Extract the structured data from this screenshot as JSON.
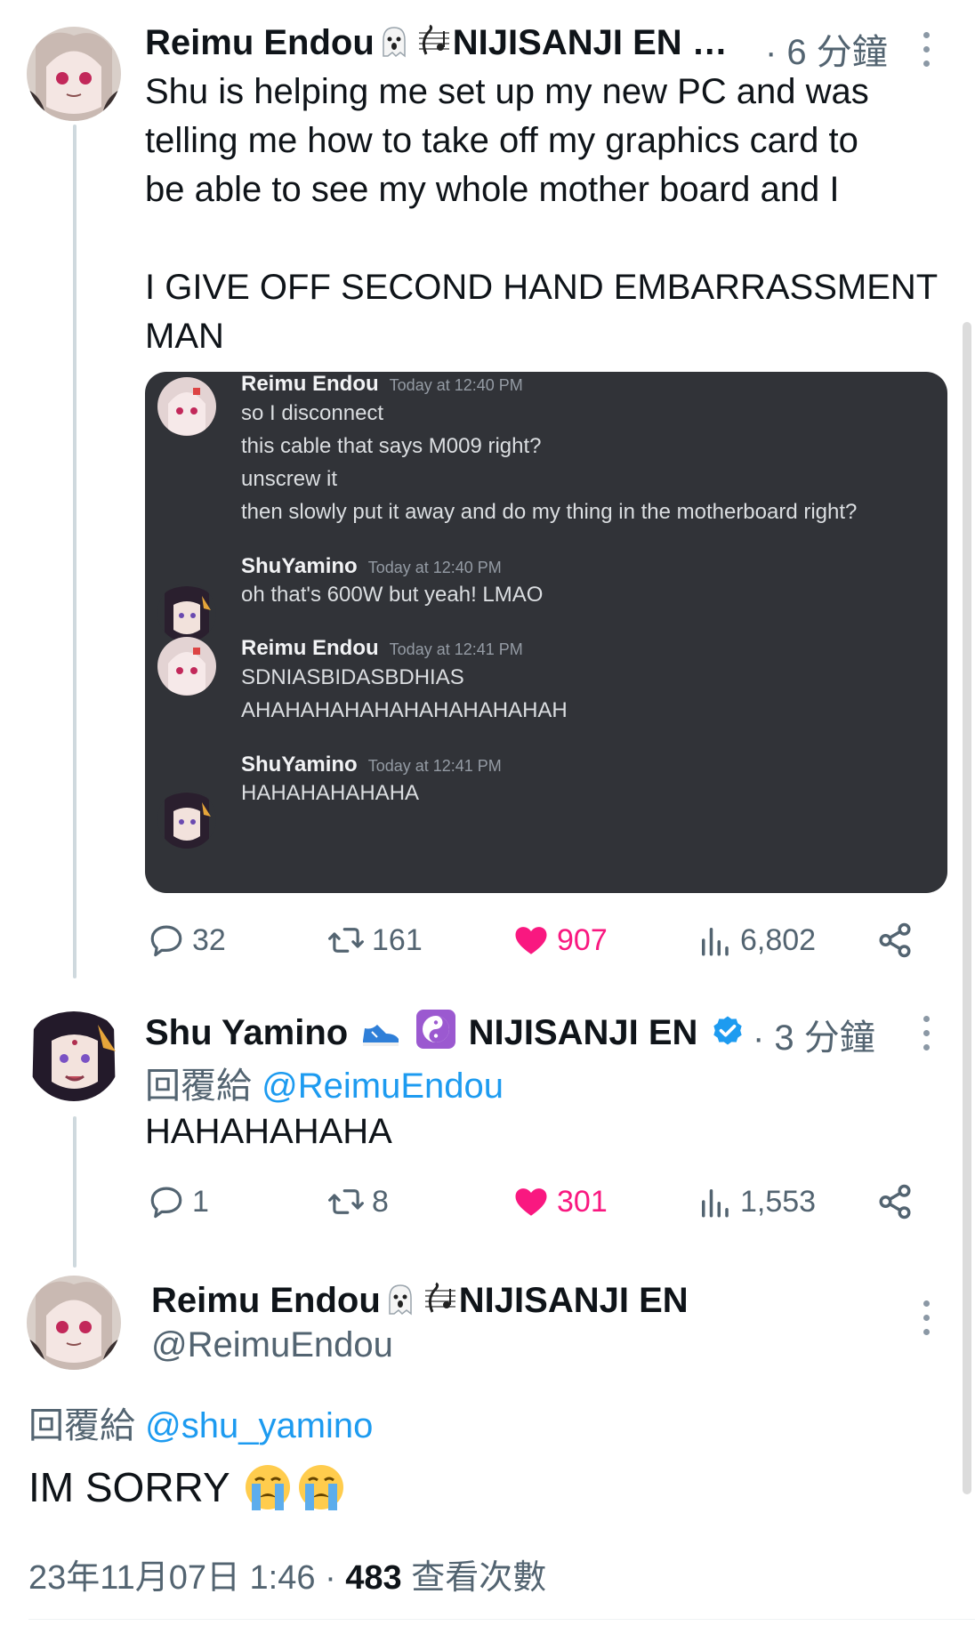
{
  "tweet1": {
    "author_name": "Reimu Endou",
    "author_suffix": "NIJISANJI EN …",
    "time": "· 6 分鐘",
    "text": "Shu is helping me set up my new PC and was\ntelling me how to take off my graphics card to\nbe able to see my whole mother board and I\n\nI GIVE OFF SECOND HAND EMBARRASSMENT\nMAN",
    "discord": {
      "messages": [
        {
          "author": "Reimu Endou",
          "time": "Today at 12:40 PM",
          "lines": [
            "so I disconnect",
            "this cable that says M009 right?",
            "unscrew it",
            "then slowly put it away and do my thing in the motherboard right?"
          ]
        },
        {
          "author": "ShuYamino",
          "time": "Today at 12:40 PM",
          "lines": [
            "oh that's 600W but yeah! LMAO"
          ]
        },
        {
          "author": "Reimu Endou",
          "time": "Today at 12:41 PM",
          "lines": [
            "SDNIASBIDASBDHIAS",
            "AHAHAHAHAHAHAHAHAHAHAH"
          ]
        },
        {
          "author": "ShuYamino",
          "time": "Today at 12:41 PM",
          "lines": [
            "HAHAHAHAHAHA"
          ]
        }
      ]
    },
    "actions": {
      "replies": "32",
      "retweets": "161",
      "likes": "907",
      "views": "6,802"
    }
  },
  "tweet2": {
    "author_name": "Shu Yamino",
    "author_suffix": "NIJISANJI EN",
    "time": "· 3 分鐘",
    "reply_label": "回覆給",
    "reply_handle": "@ReimuEndou",
    "text": "HAHAHAHAHA",
    "actions": {
      "replies": "1",
      "retweets": "8",
      "likes": "301",
      "views": "1,553"
    }
  },
  "tweet3": {
    "author_name": "Reimu Endou",
    "author_suffix": "NIJISANJI EN",
    "handle": "@ReimuEndou",
    "reply_label": "回覆給",
    "reply_handle": "@shu_yamino",
    "text": "IM SORRY",
    "date": "23年11月07日 1:46",
    "views_count": "483",
    "views_label": "查看次數"
  },
  "colors": {
    "like": "#f91880",
    "link": "#1d9bf0",
    "muted": "#536471",
    "verified": "#1d9bf0"
  },
  "icons": [
    "ghost-emoji-icon",
    "music-score-emoji-icon",
    "sneaker-emoji-icon",
    "yin-yang-emoji-icon",
    "verified-badge-icon",
    "more-icon",
    "reply-icon",
    "retweet-icon",
    "like-icon",
    "views-icon",
    "share-icon",
    "crying-face-emoji-icon"
  ]
}
